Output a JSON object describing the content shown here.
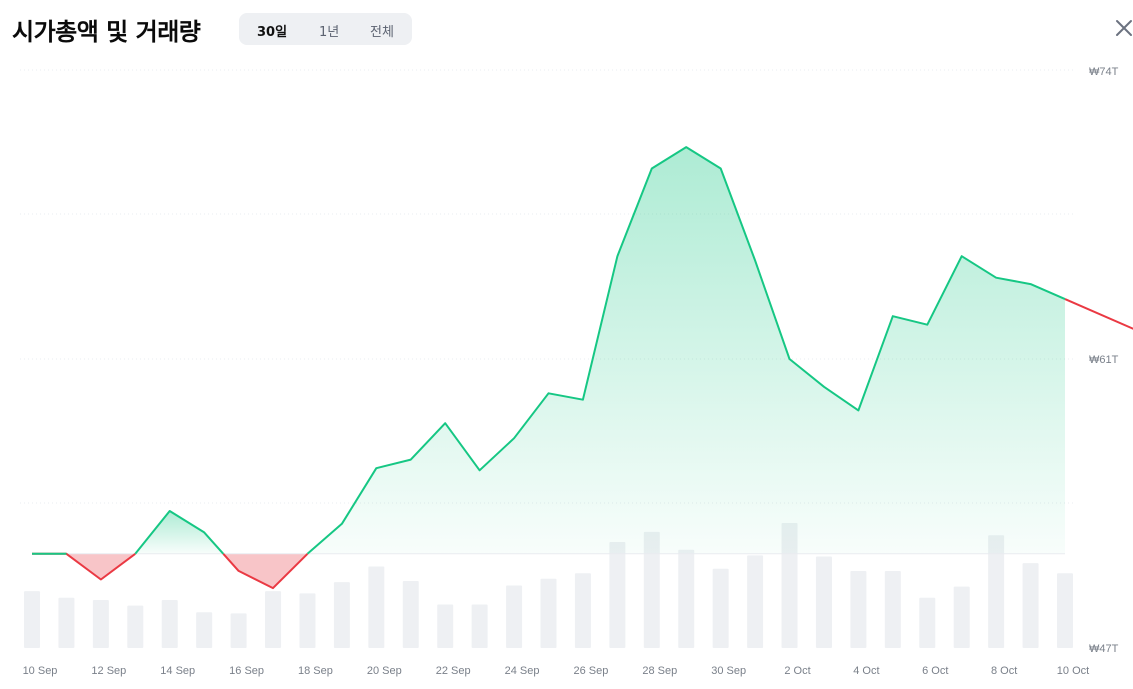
{
  "header": {
    "title": "시가총액 및 거래량",
    "tabs": [
      {
        "label": "30일",
        "active": true
      },
      {
        "label": "1년",
        "active": false
      },
      {
        "label": "전체",
        "active": false
      }
    ],
    "close_icon": "close-icon"
  },
  "colors": {
    "up_line": "#16c784",
    "down_line": "#ea3943",
    "down_fill": "#f8c5c8",
    "up_fill": "#16c784",
    "volume_bar": "#eef0f3",
    "grid": "#e9ecf0",
    "axis_text": "#7a808a"
  },
  "chart_data": {
    "type": "area",
    "currency_symbol": "₩",
    "baseline": 51.4,
    "x": [
      "10 Sep",
      "11 Sep",
      "12 Sep",
      "13 Sep",
      "14 Sep",
      "15 Sep",
      "16 Sep",
      "17 Sep",
      "18 Sep",
      "19 Sep",
      "20 Sep",
      "21 Sep",
      "22 Sep",
      "23 Sep",
      "24 Sep",
      "25 Sep",
      "26 Sep",
      "27 Sep",
      "28 Sep",
      "29 Sep",
      "30 Sep",
      "1 Oct",
      "2 Oct",
      "3 Oct",
      "4 Oct",
      "5 Oct",
      "6 Oct",
      "7 Oct",
      "8 Oct",
      "9 Oct",
      "10 Oct"
    ],
    "x_tick_labels": [
      "10 Sep",
      "12 Sep",
      "14 Sep",
      "16 Sep",
      "18 Sep",
      "20 Sep",
      "22 Sep",
      "24 Sep",
      "26 Sep",
      "28 Sep",
      "30 Sep",
      "2 Oct",
      "4 Oct",
      "6 Oct",
      "8 Oct",
      "10 Oct"
    ],
    "series": [
      {
        "name": "",
        "values": [
          51.4,
          51.4,
          50.2,
          51.4,
          53.4,
          52.4,
          50.6,
          49.8,
          51.4,
          52.8,
          55.4,
          55.8,
          57.5,
          55.3,
          56.8,
          58.9,
          58.6,
          65.3,
          69.4,
          70.4,
          69.4,
          65.1,
          60.5,
          59.2,
          58.1,
          62.5,
          62.1,
          65.3,
          64.3,
          64.0,
          63.3
        ]
      }
    ],
    "volume": [
      0.51,
      0.45,
      0.43,
      0.38,
      0.43,
      0.32,
      0.31,
      0.51,
      0.49,
      0.59,
      0.73,
      0.6,
      0.39,
      0.39,
      0.56,
      0.62,
      0.67,
      0.95,
      1.04,
      0.88,
      0.71,
      0.83,
      1.12,
      0.82,
      0.69,
      0.69,
      0.45,
      0.55,
      1.01,
      0.76,
      0.67
    ],
    "y_tick_labels": [
      "₩74T",
      "₩61T",
      "₩47T"
    ],
    "ylim": [
      47,
      74
    ],
    "grid": true
  }
}
